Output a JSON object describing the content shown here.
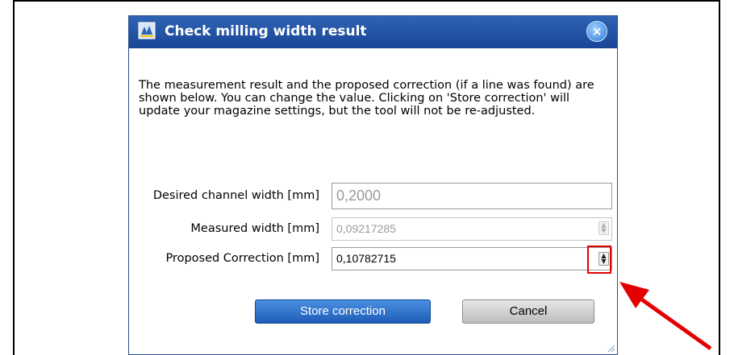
{
  "dialog": {
    "title": "Check milling width result",
    "close_symbol": "×",
    "description": "The measurement result and the proposed correction (if a line was found) are shown below. You can change the value. Clicking on 'Store correction' will update your magazine settings, but the tool will not be re-adjusted.",
    "fields": {
      "desired": {
        "label": "Desired channel width [mm]",
        "value": "0,2000",
        "enabled": false
      },
      "measured": {
        "label": "Measured width [mm]",
        "value": "0,09217285",
        "enabled": false
      },
      "proposed": {
        "label": "Proposed Correction [mm]",
        "value": "0,10782715",
        "enabled": true
      }
    },
    "buttons": {
      "store": "Store correction",
      "cancel": "Cancel"
    }
  },
  "colors": {
    "titlebar": "#1f4c9e",
    "store_button": "#2b6cc9",
    "annotation": "#e30000"
  },
  "icons": [
    "app-icon",
    "close-icon",
    "spin-up-icon",
    "spin-down-icon",
    "annotation-arrow",
    "resize-grip-icon"
  ]
}
